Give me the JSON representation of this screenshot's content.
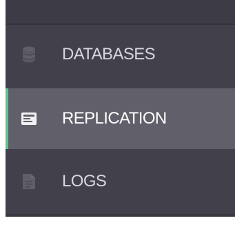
{
  "sidebar": {
    "items": [
      {
        "id": "databases",
        "label": "DATABASES",
        "icon": "database-icon",
        "active": false
      },
      {
        "id": "replication",
        "label": "REPLICATION",
        "icon": "replication-icon",
        "active": true
      },
      {
        "id": "logs",
        "label": "LOGS",
        "icon": "document-icon",
        "active": false
      }
    ]
  },
  "colors": {
    "sidebar_bg": "#42414b",
    "active_bg": "#605f6a",
    "active_accent": "#5ec38a",
    "icon_muted": "#5f5e69",
    "text": "#d7d6dc"
  }
}
